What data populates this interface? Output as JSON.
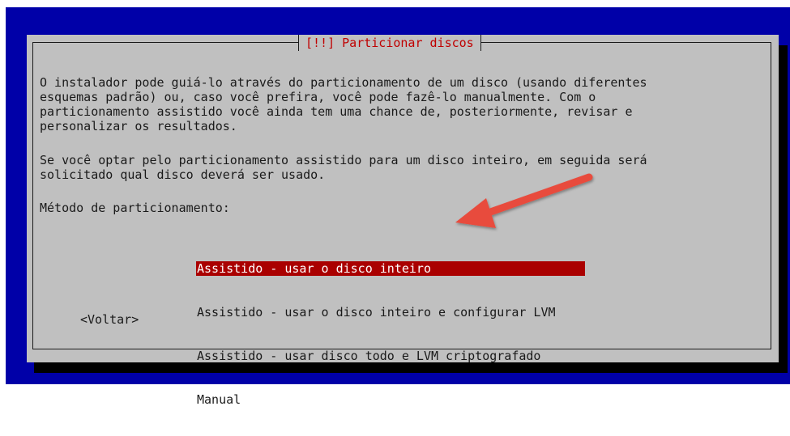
{
  "dialog": {
    "title": "[!!] Particionar discos",
    "paragraph_1": "O instalador pode guiá-lo através do particionamento de um disco (usando diferentes\nesquemas padrão) ou, caso você prefira, você pode fazê-lo manualmente. Com o\nparticionamento assistido você ainda tem uma chance de, posteriormente, revisar e\npersonalizar os resultados.",
    "paragraph_2": "Se você optar pelo particionamento assistido para um disco inteiro, em seguida será\nsolicitado qual disco deverá ser usado.",
    "method_label": "Método de particionamento:",
    "options": [
      {
        "label": "Assistido - usar o disco inteiro",
        "selected": true
      },
      {
        "label": "Assistido - usar o disco inteiro e configurar LVM",
        "selected": false
      },
      {
        "label": "Assistido - usar disco todo e LVM criptografado",
        "selected": false
      },
      {
        "label": "Manual",
        "selected": false
      }
    ],
    "back_button": "<Voltar>"
  },
  "colors": {
    "background": "#0000a8",
    "dialog": "#c0c0c0",
    "title_text": "#c00000",
    "selection": "#aa0000",
    "annotation_arrow": "#e84c3d"
  }
}
